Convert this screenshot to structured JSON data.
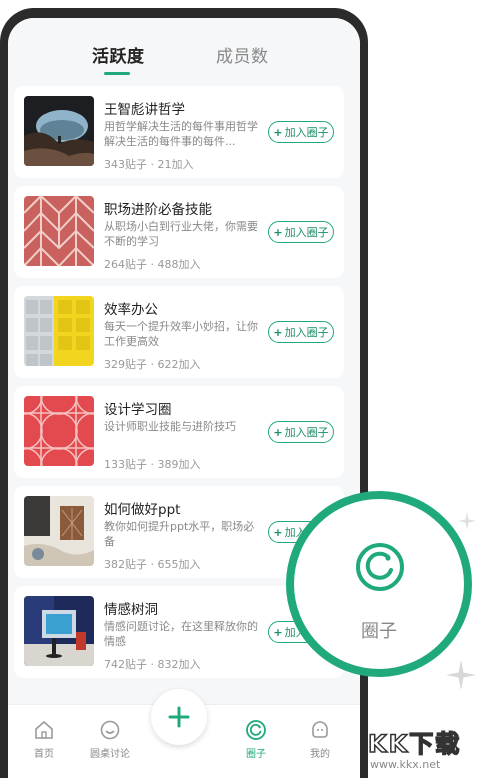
{
  "tabs": {
    "activity": "活跃度",
    "members": "成员数"
  },
  "join_label": "加入圈子",
  "circles": [
    {
      "title": "王智彪讲哲学",
      "desc": "用哲学解决生活的每件事用哲学解决生活的每件事的每件...",
      "posts": "343贴子",
      "joins": "21加入"
    },
    {
      "title": "职场进阶必备技能",
      "desc": "从职场小白到行业大佬，你需要不断的学习",
      "posts": "264贴子",
      "joins": "488加入"
    },
    {
      "title": "效率办公",
      "desc": "每天一个提升效率小妙招，让你工作更高效",
      "posts": "329贴子",
      "joins": "622加入"
    },
    {
      "title": "设计学习圈",
      "desc": "设计师职业技能与进阶技巧",
      "posts": "133贴子",
      "joins": "389加入"
    },
    {
      "title": "如何做好ppt",
      "desc": "教你如何提升ppt水平，职场必备",
      "posts": "382贴子",
      "joins": "655加入"
    },
    {
      "title": "情感树洞",
      "desc": "情感问题讨论，在这里释放你的情感",
      "posts": "742贴子",
      "joins": "832加入"
    }
  ],
  "nav": {
    "home": "首页",
    "roundtable": "圆桌讨论",
    "circle": "圈子",
    "mine": "我的"
  },
  "zoom": {
    "label": "圈子"
  },
  "watermark": {
    "text": "KK下载",
    "url": "www.kkx.net"
  },
  "colors": {
    "accent": "#1fa97c",
    "background": "#f6f7f9"
  }
}
